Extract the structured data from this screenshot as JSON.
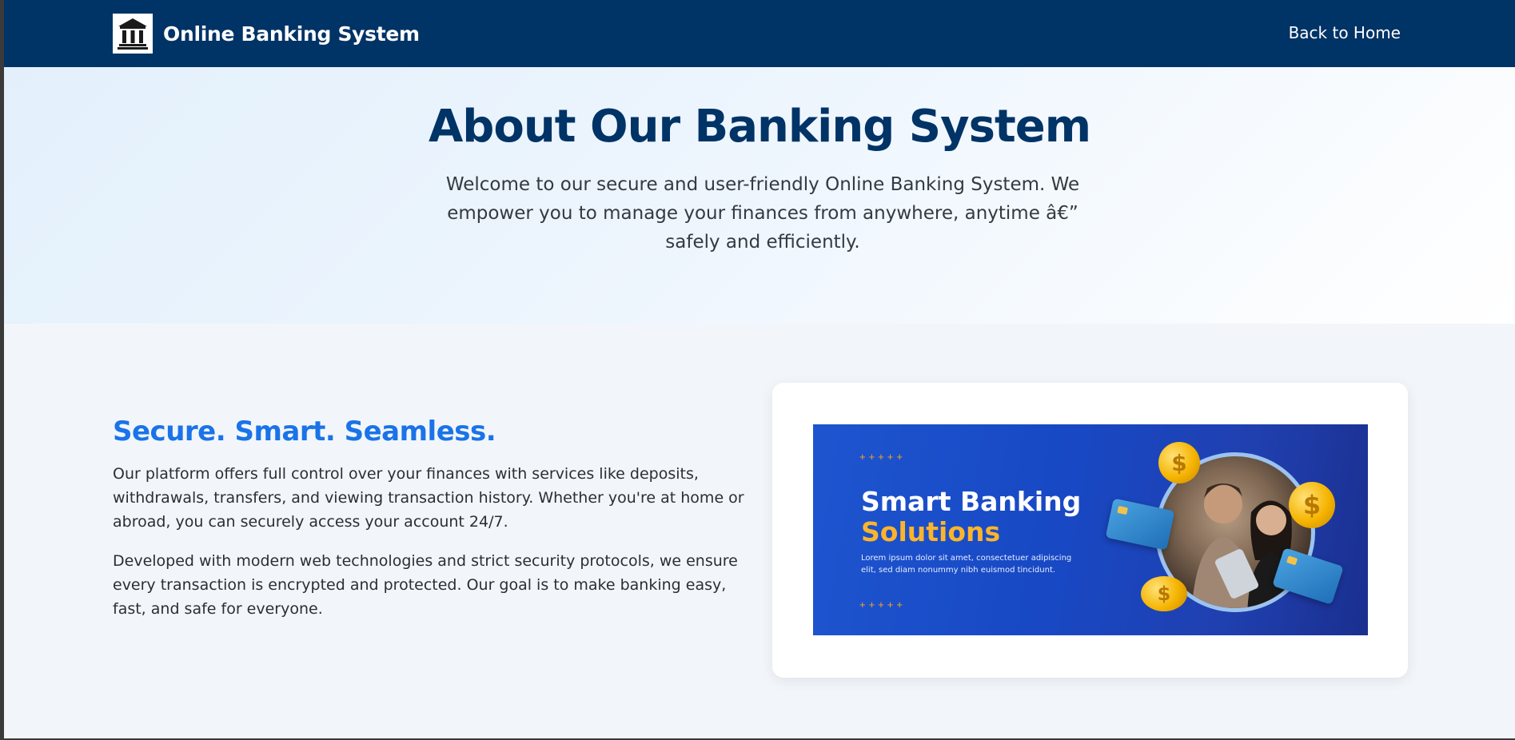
{
  "navbar": {
    "brand_title": "Online Banking System",
    "logo_icon": "bank-building-icon",
    "back_link": "Back to Home"
  },
  "hero": {
    "title": "About Our Banking System",
    "text": "Welcome to our secure and user-friendly Online Banking System. We empower you to manage your finances from anywhere, anytime â€” safely and efficiently."
  },
  "about": {
    "heading": "Secure. Smart. Seamless.",
    "paragraph1": "Our platform offers full control over your finances with services like deposits, withdrawals, transfers, and viewing transaction history. Whether you're at home or abroad, you can securely access your account 24/7.",
    "paragraph2": "Developed with modern web technologies and strict security protocols, we ensure every transaction is encrypted and protected. Our goal is to make banking easy, fast, and safe for everyone."
  },
  "banner": {
    "dots": "+++++",
    "title_line1": "Smart Banking",
    "title_line2": "Solutions",
    "subtitle": "Lorem ipsum dolor sit amet, consectetuer adipiscing elit, sed diam nonummy nibh euismod tincidunt.",
    "coin_symbol": "$"
  },
  "colors": {
    "navbar": "#003366",
    "heading_blue": "#1a73e8",
    "title_navy": "#003366",
    "banner_accent": "#fbb42c"
  }
}
